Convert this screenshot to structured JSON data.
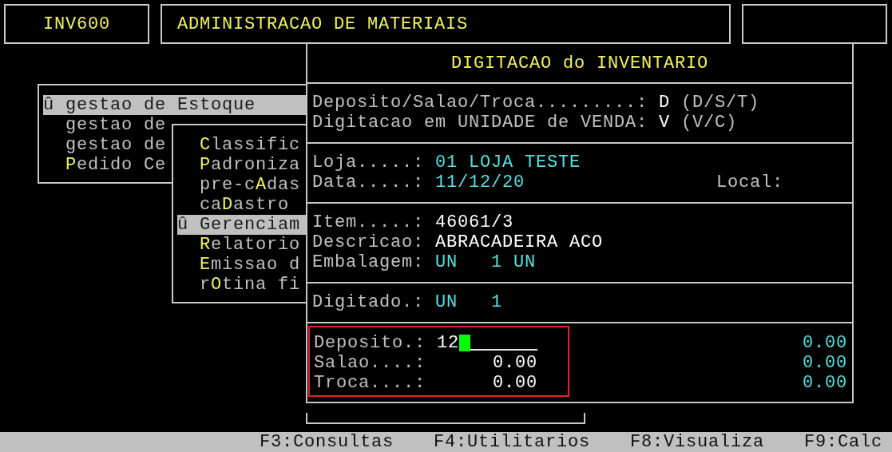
{
  "header": {
    "program": "INV600",
    "system": "ADMINISTRACAO DE MATERIAIS"
  },
  "main_menu": {
    "items": [
      {
        "marker": "û",
        "selected": true,
        "segments": [
          {
            "text": "gestao de Estoque",
            "hotkey": false
          }
        ]
      },
      {
        "selected": false,
        "segments": [
          {
            "text": "gestao de",
            "hotkey": false
          }
        ]
      },
      {
        "selected": false,
        "segments": [
          {
            "text": "gestao de",
            "hotkey": false
          }
        ]
      },
      {
        "selected": false,
        "segments": [
          {
            "text": "P",
            "hotkey": true
          },
          {
            "text": "edido Ce",
            "hotkey": false
          }
        ]
      }
    ]
  },
  "submenu": {
    "items": [
      {
        "selected": false,
        "segments": [
          {
            "text": "C",
            "hotkey": true
          },
          {
            "text": "lassific",
            "hotkey": false
          }
        ]
      },
      {
        "selected": false,
        "segments": [
          {
            "text": "P",
            "hotkey": true
          },
          {
            "text": "adroniza",
            "hotkey": false
          }
        ]
      },
      {
        "selected": false,
        "segments": [
          {
            "text": "pre-c",
            "hotkey": false
          },
          {
            "text": "A",
            "hotkey": true
          },
          {
            "text": "das",
            "hotkey": false
          }
        ]
      },
      {
        "selected": false,
        "segments": [
          {
            "text": "ca",
            "hotkey": false
          },
          {
            "text": "D",
            "hotkey": true
          },
          {
            "text": "astro",
            "hotkey": false
          }
        ]
      },
      {
        "marker": "û",
        "selected": true,
        "segments": [
          {
            "text": "Gerenciam",
            "hotkey": false
          }
        ]
      },
      {
        "selected": false,
        "segments": [
          {
            "text": "R",
            "hotkey": true
          },
          {
            "text": "elatorio",
            "hotkey": false
          }
        ]
      },
      {
        "selected": false,
        "segments": [
          {
            "text": "E",
            "hotkey": true
          },
          {
            "text": "missao d",
            "hotkey": false
          }
        ]
      },
      {
        "selected": false,
        "segments": [
          {
            "text": "r",
            "hotkey": false
          },
          {
            "text": "O",
            "hotkey": true
          },
          {
            "text": "tina fi",
            "hotkey": false
          }
        ]
      }
    ]
  },
  "dialog": {
    "title": "DIGITACAO do INVENTARIO",
    "sections": [
      {
        "fields": [
          {
            "label": "Deposito/Salao/Troca.........:",
            "value": "D",
            "kind": "entered",
            "hint": "(D/S/T)"
          },
          {
            "label": "Digitacao em UNIDADE de VENDA:",
            "value": "V",
            "kind": "entered",
            "hint": "(V/C)"
          }
        ]
      },
      {
        "fields": [
          {
            "label": "Loja.....:",
            "value": "01 LOJA TESTE",
            "kind": "system"
          },
          {
            "label": "Data.....:",
            "value": "11/12/20",
            "kind": "system",
            "side_label": "Local:"
          }
        ]
      },
      {
        "fields": [
          {
            "label": "Item.....:",
            "value": "46061/3",
            "kind": "entered"
          },
          {
            "label": "Descricao:",
            "value": "ABRACADEIRA ACO",
            "kind": "entered"
          },
          {
            "label": "Embalagem:",
            "value": "UN   1 UN",
            "kind": "system"
          }
        ]
      },
      {
        "fields": [
          {
            "label": "Digitado.:",
            "value": "UN   1",
            "kind": "system"
          }
        ]
      }
    ],
    "quantities": [
      {
        "label": "Deposito.:",
        "value": "12",
        "focused": true,
        "total": "0.00"
      },
      {
        "label": "Salao....:",
        "value": "0.00",
        "focused": false,
        "total": "0.00"
      },
      {
        "label": "Troca....:",
        "value": "0.00",
        "focused": false,
        "total": "0.00"
      }
    ]
  },
  "function_keys": [
    "F3:Consultas",
    "F4:Utilitarios",
    "F8:Visualiza",
    "F9:Calc"
  ]
}
